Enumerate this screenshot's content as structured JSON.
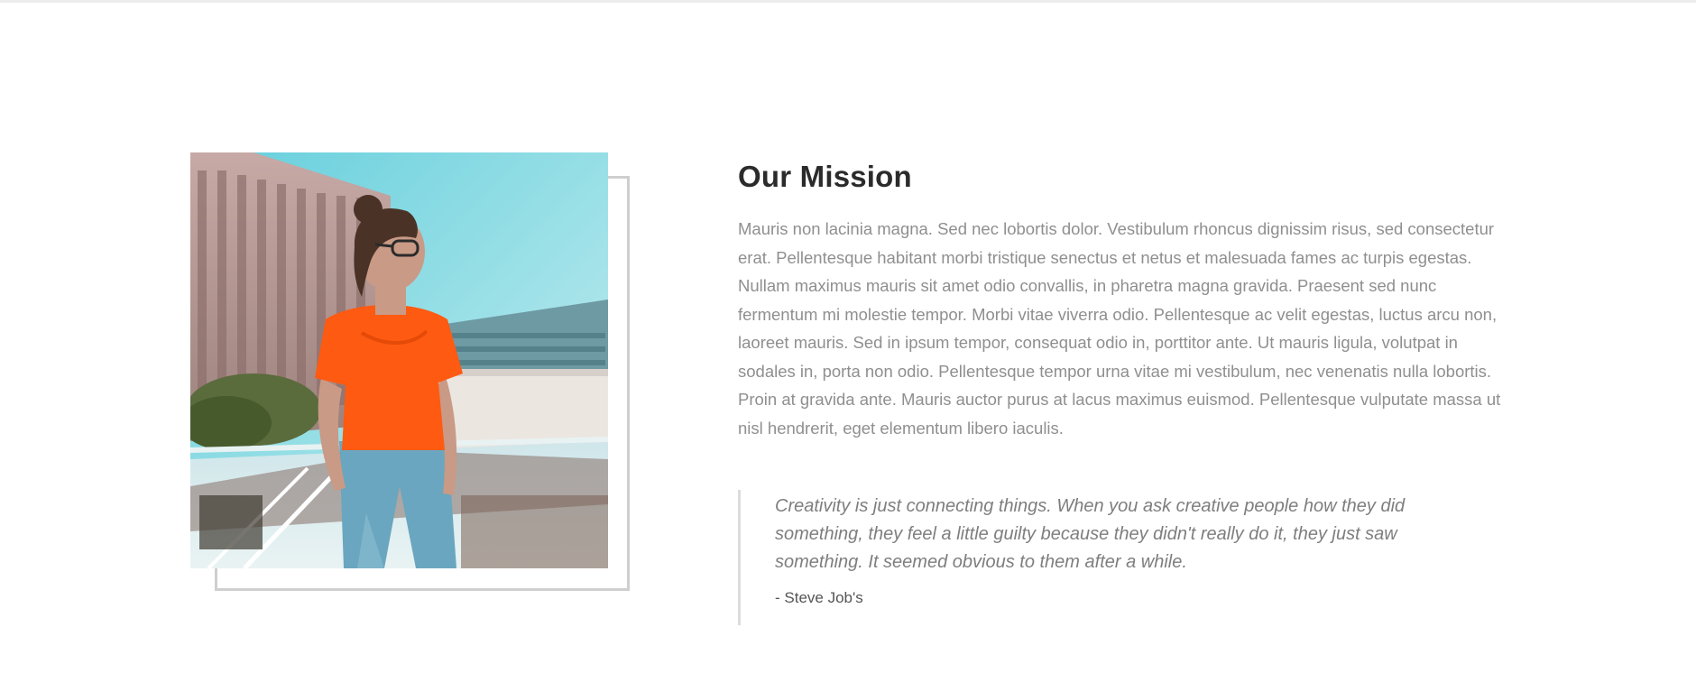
{
  "mission": {
    "title": "Our Mission",
    "paragraph": "Mauris non lacinia magna. Sed nec lobortis dolor. Vestibulum rhoncus dignissim risus, sed consectetur erat. Pellentesque habitant morbi tristique senectus et netus et malesuada fames ac turpis egestas. Nullam maximus mauris sit amet odio convallis, in pharetra magna gravida. Praesent sed nunc fermentum mi molestie tempor. Morbi vitae viverra odio. Pellentesque ac velit egestas, luctus arcu non, laoreet mauris. Sed in ipsum tempor, consequat odio in, porttitor ante. Ut mauris ligula, volutpat in sodales in, porta non odio. Pellentesque tempor urna vitae mi vestibulum, nec venenatis nulla lobortis. Proin at gravida ante. Mauris auctor purus at lacus maximus euismod. Pellentesque vulputate massa ut nisl hendrerit, eget elementum libero iaculis."
  },
  "quote": {
    "text": "Creativity is just connecting things. When you ask creative people how they did something, they feel a little guilty because they didn't really do it, they just saw something. It seemed obvious to them after a while.",
    "author": "- Steve Job's"
  },
  "colors": {
    "title": "#2b2b2b",
    "body_text": "#8f8f8f",
    "frame_border": "#cfcfcf",
    "shirt_orange": "#ff5a12"
  }
}
